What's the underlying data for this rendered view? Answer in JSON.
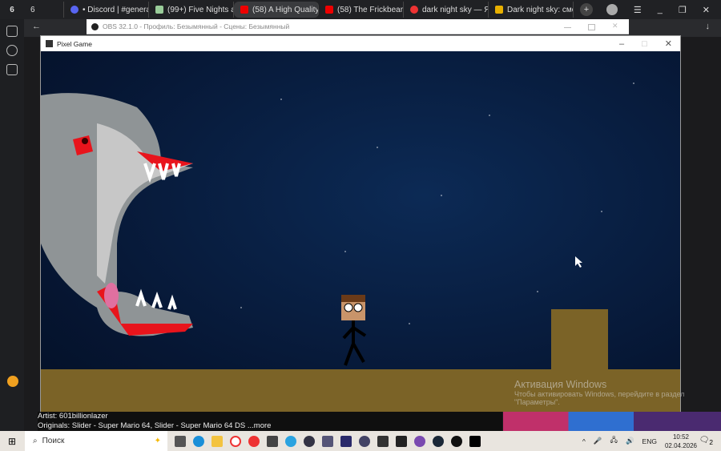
{
  "browser": {
    "tabs": [
      {
        "label": "6",
        "color": "#666"
      },
      {
        "label": "• Discord | #general |",
        "color": "#5865f2"
      },
      {
        "label": "(99+) Five Nights at W",
        "color": "#9c9"
      },
      {
        "label": "(58) A High Quality",
        "color": "#e00",
        "active": true
      },
      {
        "label": "(58) The Frickbear Fo",
        "color": "#e00"
      },
      {
        "label": "dark night sky — Янд",
        "color": "#e33"
      },
      {
        "label": "Dark night sky: смотр",
        "color": "#e8b000"
      }
    ],
    "new_tab": "+",
    "workspace": "6"
  },
  "obs": {
    "title": "OBS 32.1.0 - Профиль: Безымянный - Сцены: Безымянный"
  },
  "game": {
    "title": "Pixel Game",
    "minimize": "–",
    "maximize": "□",
    "close": "✕",
    "colors": {
      "ground": "#7b6327",
      "sky": "#061633"
    }
  },
  "video": {
    "artist": "Artist: 601billionlazer",
    "originals": "Originals: Slider - Super Mario 64, Slider - Super Mario 64 DS",
    "more": "...more"
  },
  "activation": {
    "title": "Активация Windows",
    "text": "Чтобы активировать Windows, перейдите в раздел",
    "text2": "\"Параметры\"."
  },
  "taskbar": {
    "search_placeholder": "Поиск",
    "lang": "ENG",
    "time": "10:52",
    "date": "02.04.2026",
    "notifications": "2"
  }
}
